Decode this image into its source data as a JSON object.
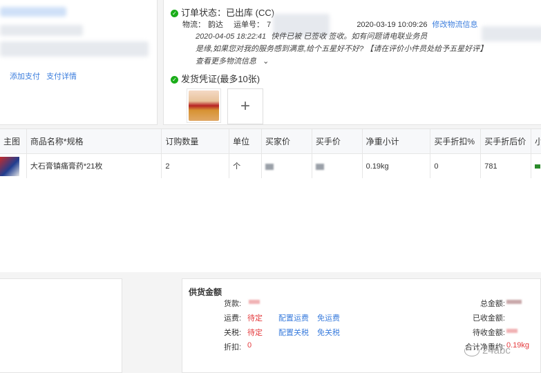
{
  "order_info": {
    "actions": [
      "添加支付",
      "支付详情"
    ]
  },
  "logistics_status": {
    "title": "订单状态：已出库 (CC)",
    "carrier_label": "物流：",
    "carrier": "韵达",
    "tracking_label": "运单号：",
    "tracking_no": "7",
    "datetime": "2020-03-19 10:09:26",
    "modify_link": "修改物流信息",
    "track_line1_time": "2020-04-05 18:22:41",
    "track_line1_text": "快件已被 已签收 签收。如有问题请电联业务员",
    "track_line2": "是缘,如果您对我的服务感到满意,给个五星好不好? 【请在评价小件员处给予五星好评】",
    "more_link": "查看更多物流信息",
    "more_icon": "chevron-down-icon"
  },
  "voucher": {
    "title": "发货凭证(最多10张)",
    "add_symbol": "+"
  },
  "table": {
    "headers": [
      "主图",
      "商品名称*规格",
      "订购数量",
      "单位",
      "买家价",
      "买手价",
      "净重小计",
      "买手折扣%",
      "买手折后价",
      "小"
    ],
    "row": {
      "name": "大石膏镇痛膏药*21枚",
      "qty": "2",
      "unit": "个",
      "net_weight": "0.19kg",
      "discount": "0",
      "discount_price": "781"
    }
  },
  "supply_amount": {
    "title": "供货金额",
    "goods_label": "货款:",
    "freight_label": "运费:",
    "freight_value": "待定",
    "freight_config": "配置运费",
    "freight_free": "免运费",
    "tax_label": "关税:",
    "tax_value": "待定",
    "tax_config": "配置关税",
    "tax_free": "免关税",
    "discount_label": "折扣:",
    "discount_value": "0",
    "total_label": "总金额:",
    "received_label": "已收金额:",
    "pending_label": "待收金额:",
    "net_weight_label": "合计净重约:",
    "net_weight_value": "0.19kg"
  },
  "watermark": "24abc",
  "colors": {
    "link": "#3b7ddd",
    "red": "#e4393c",
    "success": "#1aad19"
  }
}
